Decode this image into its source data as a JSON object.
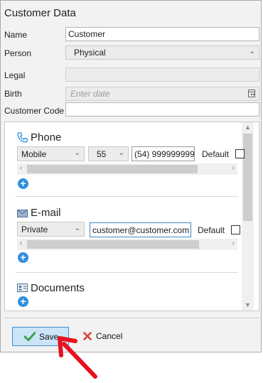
{
  "window": {
    "title": "Customer Data"
  },
  "form": {
    "name_label": "Name",
    "name_value": "Customer",
    "person_label": "Person",
    "person_value": "Physical",
    "legal_label": "Legal",
    "birth_label": "Birth",
    "birth_placeholder": "Enter date",
    "customer_code_label": "Customer Code"
  },
  "phone": {
    "title": "Phone",
    "type_value": "Mobile",
    "country_code": "55",
    "number": "(54) 999999999",
    "default_label": "Default"
  },
  "email": {
    "title": "E-mail",
    "type_value": "Private",
    "address": "customer@customer.com",
    "default_label": "Default"
  },
  "documents": {
    "title": "Documents"
  },
  "buttons": {
    "save_label": "Save",
    "cancel_label": "Cancel"
  },
  "colors": {
    "accent": "#2f8fdf",
    "save_bg": "#cce4f7",
    "cancel_icon": "#d9413a",
    "save_icon": "#3aa34a",
    "annotation_arrow": "#e8101e"
  },
  "icons": {
    "phone": "phone-icon",
    "email": "envelope-icon",
    "documents": "id-card-icon",
    "calendar": "calendar-icon",
    "save": "checkmark-icon",
    "cancel": "x-icon"
  }
}
